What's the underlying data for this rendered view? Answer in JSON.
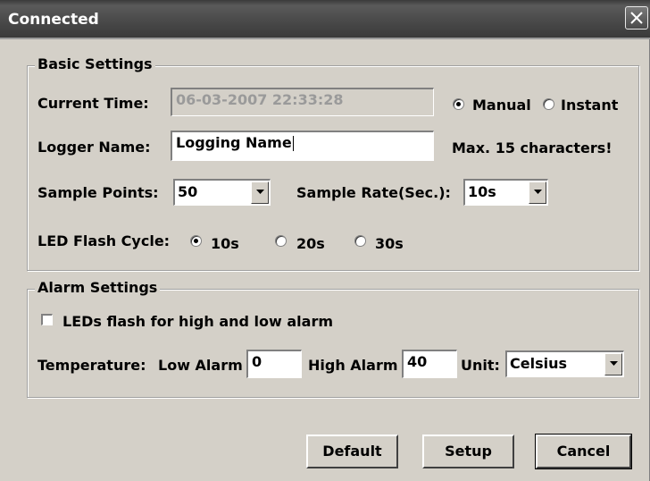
{
  "window": {
    "title": "Connected"
  },
  "basic": {
    "title": "Basic Settings",
    "current_time_label": "Current Time:",
    "current_time_value": "06-03-2007 22:33:28",
    "mode_options": [
      "Manual",
      "Instant"
    ],
    "mode_selected": "Manual",
    "logger_name_label": "Logger Name:",
    "logger_name_value": "Logging Name",
    "logger_name_hint": "Max. 15 characters!",
    "sample_points_label": "Sample Points:",
    "sample_points_value": "50",
    "sample_rate_label": "Sample Rate(Sec.):",
    "sample_rate_value": "10s",
    "led_flash_label": "LED Flash Cycle:",
    "led_flash_options": [
      "10s",
      "20s",
      "30s"
    ],
    "led_flash_selected": "10s"
  },
  "alarm": {
    "title": "Alarm Settings",
    "led_alarm_label": "LEDs flash for high and low alarm",
    "led_alarm_checked": false,
    "temperature_label": "Temperature:",
    "low_alarm_label": "Low Alarm",
    "low_alarm_value": "0",
    "high_alarm_label": "High Alarm",
    "high_alarm_value": "40",
    "unit_label": "Unit:",
    "unit_value": "Celsius"
  },
  "buttons": {
    "default": "Default",
    "setup": "Setup",
    "cancel": "Cancel"
  }
}
